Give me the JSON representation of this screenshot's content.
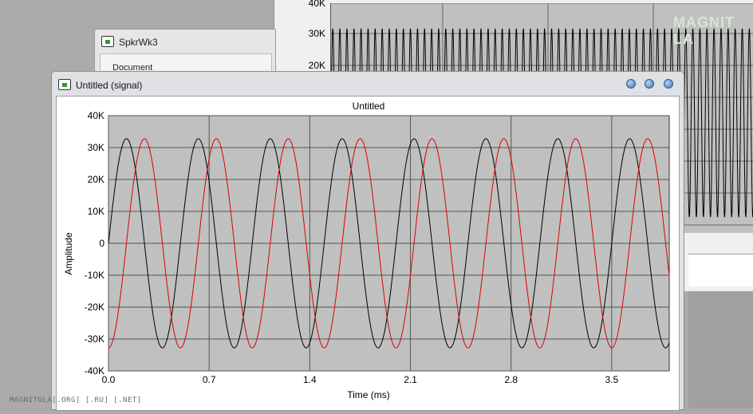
{
  "background_window": {
    "y_ticks": [
      "40K",
      "30K",
      "20K"
    ],
    "watermark": "MAGNIT LA"
  },
  "second_window": {
    "title": "SpkrWk3",
    "group_label": "Document"
  },
  "main_window": {
    "title": "Untitled (signal)",
    "buttons": [
      "minimize",
      "maximize",
      "close"
    ]
  },
  "footer_watermark": "MAGNITOLA[.ORG] [.RU] [.NET]",
  "colors": {
    "series_black": "#000000",
    "series_red": "#dd0000",
    "plot_bg": "#c0c0c0"
  },
  "chart_data": {
    "type": "line",
    "title": "Untitled",
    "xlabel": "Time (ms)",
    "ylabel": "Amplitude",
    "xlim": [
      0,
      3.9
    ],
    "ylim": [
      -40000,
      40000
    ],
    "x_ticks": [
      0.0,
      0.7,
      1.4,
      2.1,
      2.8,
      3.5
    ],
    "x_tick_labels": [
      "0.0",
      "0.7",
      "1.4",
      "2.1",
      "2.8",
      "3.5"
    ],
    "y_ticks": [
      40000,
      30000,
      20000,
      10000,
      0,
      -10000,
      -20000,
      -30000,
      -40000
    ],
    "y_tick_labels": [
      "40K",
      "30K",
      "20K",
      "10K",
      "0",
      "-10K",
      "-20K",
      "-30K",
      "-40K"
    ],
    "grid": true,
    "series": [
      {
        "color": "#000000",
        "amplitude": 32768,
        "frequency_khz": 2.0,
        "waveform": "sine",
        "phase_deg": 0
      },
      {
        "color": "#dd0000",
        "amplitude": 32768,
        "frequency_khz": 2.0,
        "waveform": "sine",
        "phase_deg": -90
      }
    ]
  }
}
